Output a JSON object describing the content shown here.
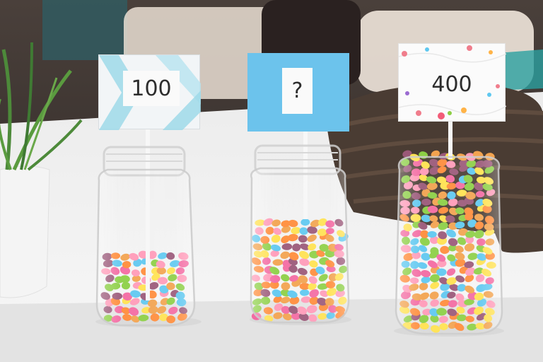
{
  "photo": {
    "signs": [
      {
        "label": "100",
        "color": "#f2f5f7",
        "accent": "#9fd9e9"
      },
      {
        "label": "?",
        "color": "#6cc3ec"
      },
      {
        "label": "400",
        "color": "#fbfbfb",
        "accent": "#f07d8c"
      }
    ],
    "colors": {
      "table": "#f2f2f0",
      "background": "#3b3431",
      "candy": [
        "#ff9ab8",
        "#ff8c3a",
        "#ffe14f",
        "#5fc8f0",
        "#8ccf45",
        "#9a5878",
        "#f36aa2",
        "#f2a34f"
      ]
    }
  }
}
